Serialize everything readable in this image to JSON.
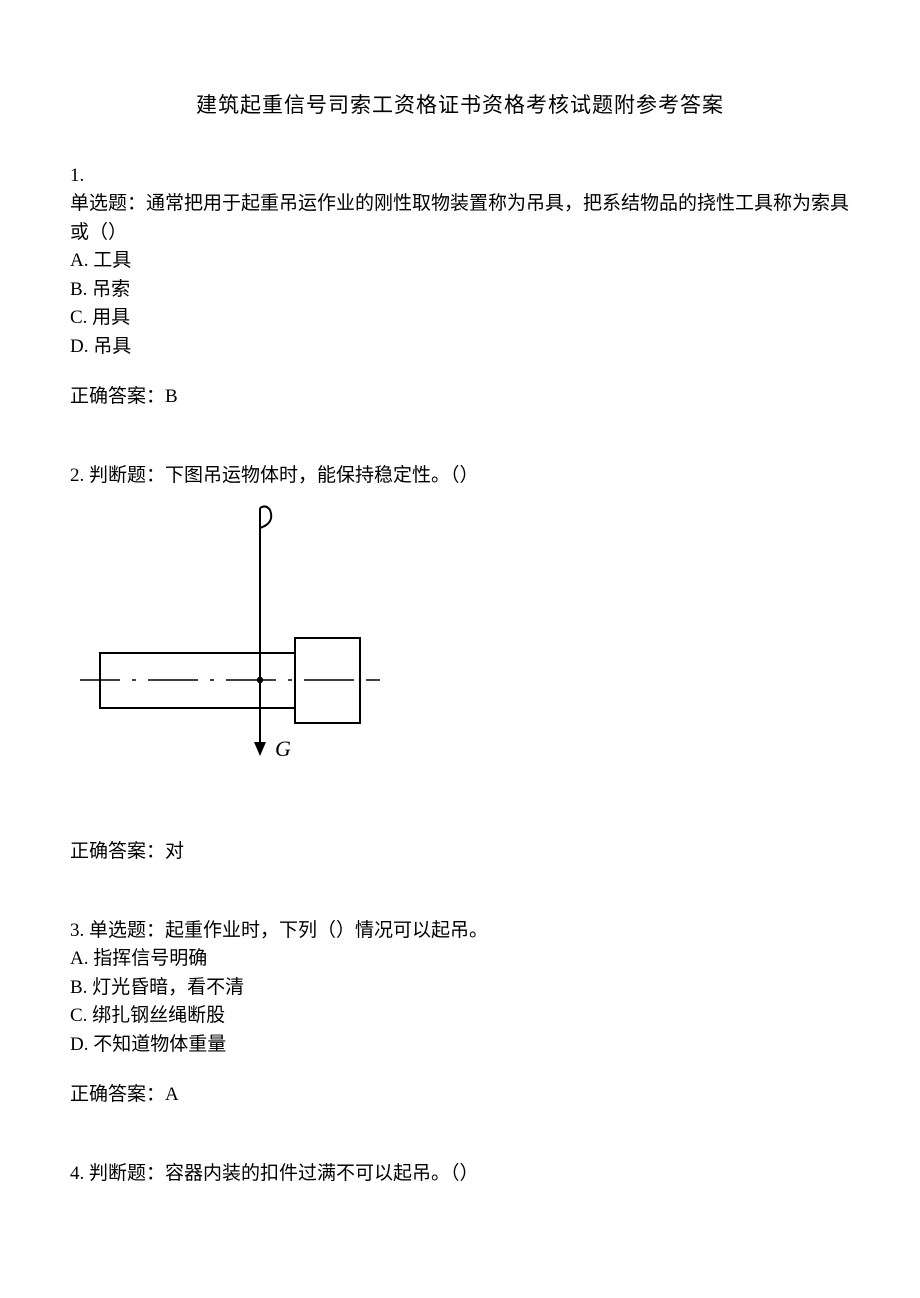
{
  "title": "建筑起重信号司索工资格证书资格考核试题附参考答案",
  "q1": {
    "num": "1.",
    "stem": "单选题：通常把用于起重吊运作业的刚性取物装置称为吊具，把系结物品的挠性工具称为索具或（）",
    "a": "A. 工具",
    "b": "B. 吊索",
    "c": "C. 用具",
    "d": "D. 吊具",
    "ans": "正确答案：B"
  },
  "q2": {
    "line": "2.  判断题：下图吊运物体时，能保持稳定性。（）",
    "g_label": "G",
    "ans": "正确答案：对"
  },
  "q3": {
    "line": "3.  单选题：起重作业时，下列（）情况可以起吊。",
    "a": "A. 指挥信号明确",
    "b": "B. 灯光昏暗，看不清",
    "c": "C. 绑扎钢丝绳断股",
    "d": "D. 不知道物体重量",
    "ans": "正确答案：A"
  },
  "q4": {
    "line": "4.  判断题：容器内装的扣件过满不可以起吊。（）"
  }
}
